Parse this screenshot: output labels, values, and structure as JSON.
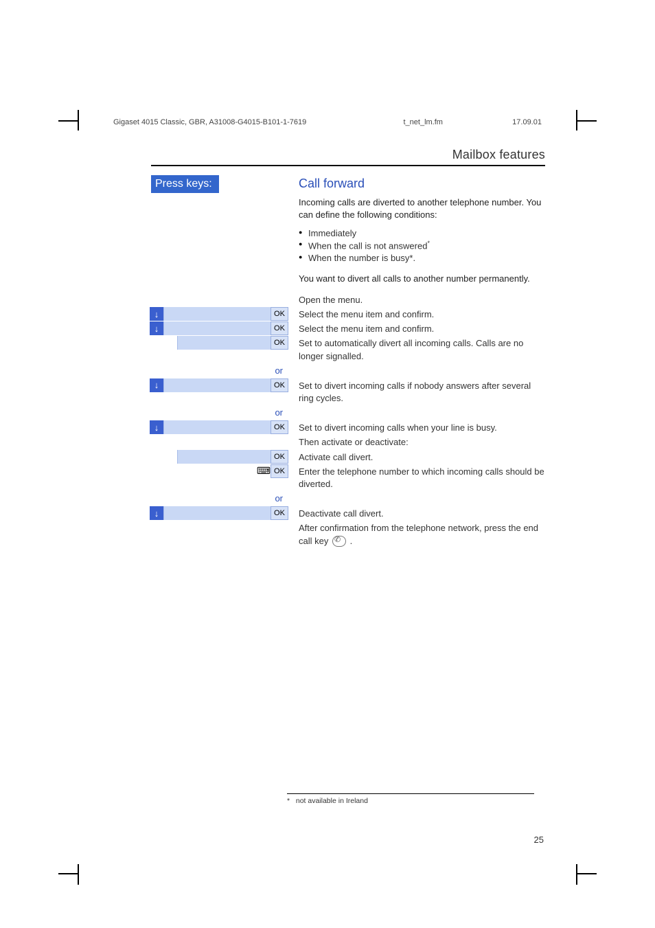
{
  "meta": {
    "left": "Gigaset 4015 Classic, GBR, A31008-G4015-B101-1-7619",
    "center": "t_net_lm.fm",
    "right": "17.09.01"
  },
  "section_title": "Mailbox features",
  "press_keys": "Press keys:",
  "heading": "Call forward",
  "intro": "Incoming calls are diverted to another telephone number. You can define the following conditions:",
  "bullets": {
    "b1": "Immediately",
    "b2_pre": "When the call is not answered",
    "b2_sup": "*",
    "b3": "When the number is busy*."
  },
  "para2": "You want to divert all calls to another number permanently.",
  "rows": {
    "open_menu": "Open the menu.",
    "select1": "Select the menu item and confirm.",
    "select2": "Select the menu item and confirm.",
    "auto_divert": "Set to automatically divert all incoming calls. Calls are no longer signalled.",
    "no_answer": "Set to divert incoming calls if nobody answers after several ring cycles.",
    "busy": "Set to divert incoming calls when your line is busy.",
    "then_activate": "Then activate or deactivate:",
    "activate": "Activate call divert.",
    "enter_num": "Enter the telephone number to which incoming calls should be diverted.",
    "deactivate": "Deactivate call divert.",
    "after_confirm_pre": "After confirmation from the telephone network, press the end call key ",
    "after_confirm_post": " ."
  },
  "or": "or",
  "ok": "OK",
  "footnote_marker": "*",
  "footnote": "not available in Ireland",
  "page_number": "25"
}
